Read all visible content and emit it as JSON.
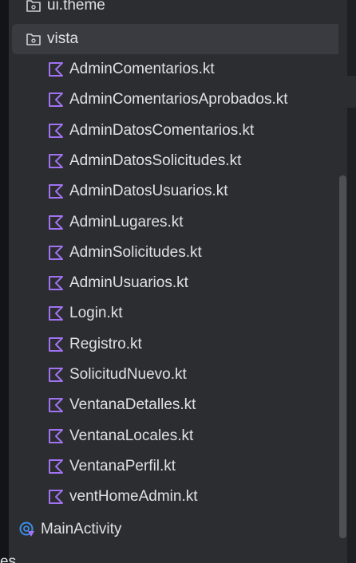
{
  "project_tree": {
    "clipped_top_folder": {
      "label": "ui.theme",
      "icon": "package-folder-icon"
    },
    "folder": {
      "label": "vista",
      "icon": "package-folder-icon"
    },
    "files": [
      {
        "label": "AdminComentarios.kt",
        "icon": "kotlin-file-icon"
      },
      {
        "label": "AdminComentariosAprobados.kt",
        "icon": "kotlin-file-icon"
      },
      {
        "label": "AdminDatosComentarios.kt",
        "icon": "kotlin-file-icon"
      },
      {
        "label": "AdminDatosSolicitudes.kt",
        "icon": "kotlin-file-icon"
      },
      {
        "label": "AdminDatosUsuarios.kt",
        "icon": "kotlin-file-icon"
      },
      {
        "label": "AdminLugares.kt",
        "icon": "kotlin-file-icon"
      },
      {
        "label": "AdminSolicitudes.kt",
        "icon": "kotlin-file-icon"
      },
      {
        "label": "AdminUsuarios.kt",
        "icon": "kotlin-file-icon"
      },
      {
        "label": "Login.kt",
        "icon": "kotlin-file-icon"
      },
      {
        "label": "Registro.kt",
        "icon": "kotlin-file-icon"
      },
      {
        "label": "SolicitudNuevo.kt",
        "icon": "kotlin-file-icon"
      },
      {
        "label": "VentanaDetalles.kt",
        "icon": "kotlin-file-icon"
      },
      {
        "label": "VentanaLocales.kt",
        "icon": "kotlin-file-icon"
      },
      {
        "label": "VentanaPerfil.kt",
        "icon": "kotlin-file-icon"
      },
      {
        "label": "ventHomeAdmin.kt",
        "icon": "kotlin-file-icon"
      }
    ],
    "activity": {
      "label": "MainActivity",
      "icon": "compose-activity-icon"
    },
    "clipped_bottom": {
      "label": "es"
    }
  },
  "colors": {
    "panel_bg": "#2b2d30",
    "selection_bg": "#393b40",
    "text": "#dfe1e5",
    "kotlin_icon": "#a173f2",
    "folder_icon": "#ced0d6",
    "activity_icon_blue": "#3d8fe6"
  }
}
